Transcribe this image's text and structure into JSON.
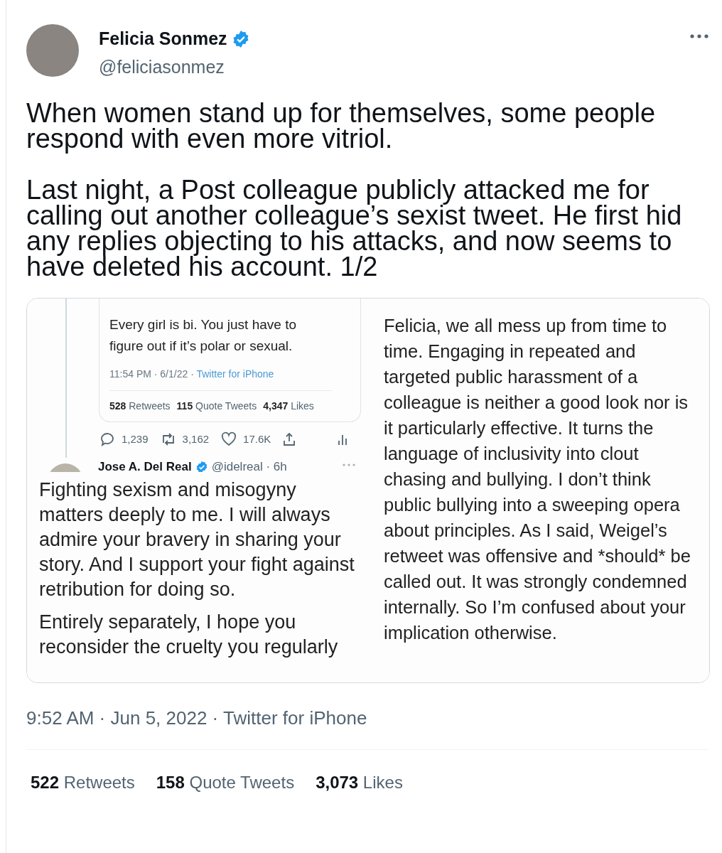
{
  "author": {
    "name": "Felicia Sonmez",
    "handle": "@feliciasonmez",
    "verified": true
  },
  "text": [
    "When women stand up for themselves, some people respond with even more vitriol.",
    "Last night, a Post colleague publicly attacked me for calling out another colleague’s sexist tweet. He first hid any replies objecting to his attacks, and now seems to have deleted his account. 1/2"
  ],
  "media": {
    "quoted_tweet": {
      "text": "Every girl is bi. You just have to figure out if it’s polar or sexual.",
      "meta": "11:54 PM · 6/1/22 ·",
      "source": "Twitter for iPhone",
      "stats": [
        {
          "count": "528",
          "label": "Retweets"
        },
        {
          "count": "115",
          "label": "Quote Tweets"
        },
        {
          "count": "4,347",
          "label": "Likes"
        }
      ]
    },
    "actions": [
      {
        "kind": "reply",
        "count": "1,239"
      },
      {
        "kind": "retweet",
        "count": "3,162"
      },
      {
        "kind": "like",
        "count": "17.6K"
      },
      {
        "kind": "share"
      },
      {
        "kind": "analytics"
      }
    ],
    "reply": {
      "name": "Jose A. Del Real",
      "verified": true,
      "handle_time": "@idelreal · 6h",
      "paragraphs": [
        "Fighting sexism and misogyny matters deeply to me. I will always admire your bravery in sharing your story.  And I support your fight against retribution for doing so.",
        "Entirely separately, I hope you reconsider the cruelty you regularly"
      ]
    },
    "right_texts": [
      "Felicia, we all mess up from time to time. Engaging in repeated and targeted public harassment of a colleague is neither a good look nor is it particularly effective. It turns the language of inclusivity into clout chasing and bullying. I don’t think",
      "public bullying into a sweeping opera about principles. As I said, Weigel’s retweet was offensive and *should* be called out. It was strongly condemned internally. So I’m confused about your implication otherwise."
    ]
  },
  "timestamp": "9:52 AM · Jun 5, 2022 · Twitter for iPhone",
  "stats": [
    {
      "count": "522",
      "label": "Retweets"
    },
    {
      "count": "158",
      "label": "Quote Tweets"
    },
    {
      "count": "3,073",
      "label": "Likes"
    }
  ]
}
